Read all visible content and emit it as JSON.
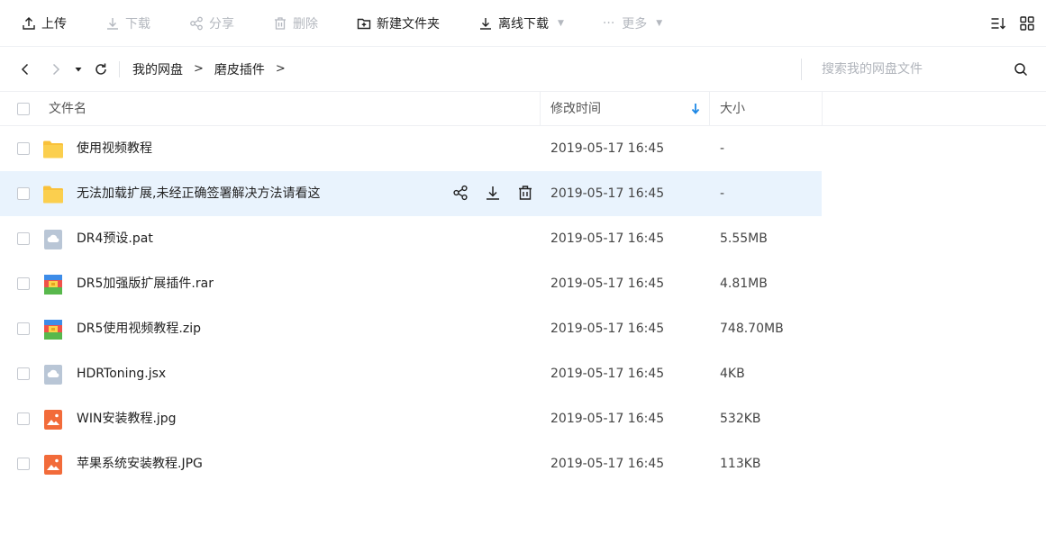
{
  "toolbar": {
    "upload": "上传",
    "download": "下载",
    "share": "分享",
    "delete": "删除",
    "new_folder": "新建文件夹",
    "offline_download": "离线下载",
    "more": "更多",
    "more_dots": "···"
  },
  "address": {
    "crumbs": [
      "我的网盘",
      "磨皮插件"
    ],
    "separator": ">",
    "search_placeholder": "搜索我的网盘文件"
  },
  "table": {
    "headers": {
      "name": "文件名",
      "modified": "修改时间",
      "size": "大小"
    },
    "rows": [
      {
        "icon": "folder-icon",
        "name": "使用视频教程",
        "date": "2019-05-17 16:45",
        "size": "-"
      },
      {
        "icon": "folder-icon",
        "name": "无法加载扩展,未经正确签署解决方法请看这",
        "date": "2019-05-17 16:45",
        "size": "-"
      },
      {
        "icon": "generic-file-icon",
        "name": "DR4预设.pat",
        "date": "2019-05-17 16:45",
        "size": "5.55MB"
      },
      {
        "icon": "archive-icon",
        "name": "DR5加强版扩展插件.rar",
        "date": "2019-05-17 16:45",
        "size": "4.81MB"
      },
      {
        "icon": "archive-icon",
        "name": "DR5使用视频教程.zip",
        "date": "2019-05-17 16:45",
        "size": "748.70MB"
      },
      {
        "icon": "generic-file-icon",
        "name": "HDRToning.jsx",
        "date": "2019-05-17 16:45",
        "size": "4KB"
      },
      {
        "icon": "image-file-icon",
        "name": "WIN安装教程.jpg",
        "date": "2019-05-17 16:45",
        "size": "532KB"
      },
      {
        "icon": "image-file-icon",
        "name": "苹果系统安装教程.JPG",
        "date": "2019-05-17 16:45",
        "size": "113KB"
      }
    ]
  },
  "colors": {
    "accent": "#1e88e5",
    "hover_row": "#e9f3fd",
    "folder": "#f9c13a",
    "image_file": "#f26b3a",
    "generic_file": "#b9c6d6"
  }
}
